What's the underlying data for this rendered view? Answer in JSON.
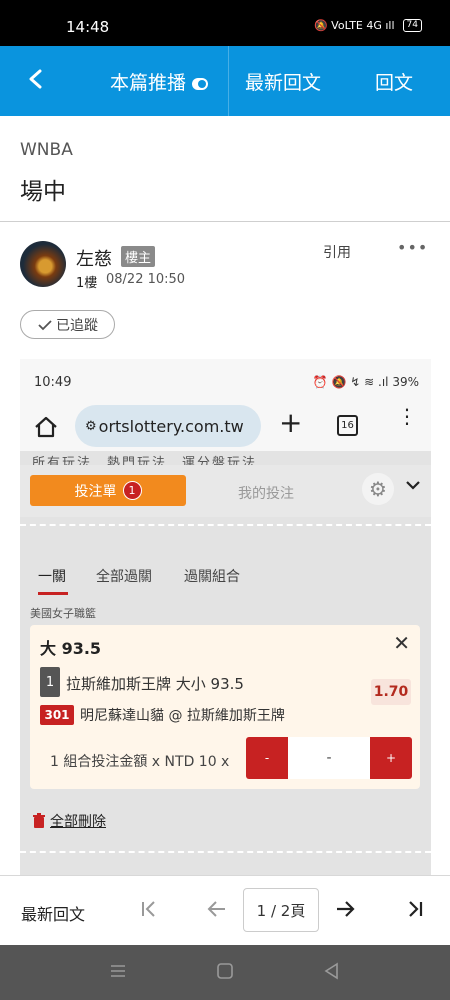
{
  "status_bar": {
    "time": "14:48",
    "indicators": "🔕 VoLTE 4G ıll",
    "battery": "74"
  },
  "app_bar": {
    "back_icon": "back-arrow-icon",
    "tabs": [
      {
        "label": "本篇推播",
        "toggle": "on"
      },
      {
        "label": "最新回文"
      },
      {
        "label": "回文"
      }
    ]
  },
  "thread": {
    "board": "WNBA",
    "title": "場中"
  },
  "post": {
    "author": "左慈",
    "badge": "樓主",
    "floor": "1樓",
    "datetime": "08/22 10:50",
    "quote_label": "引用",
    "more_label": "•••",
    "follow_label": "已追蹤"
  },
  "embedded": {
    "time": "10:49",
    "status_icons": "⏰ 🔕 ↯ ≋ .ıl 39%",
    "url": "ortslottery.com.tw",
    "tab_count": "16",
    "peek_text": "所有玩法　熱門玩法　運分盤玩法",
    "bet_slip_label": "投注單",
    "bet_count": "1",
    "my_bets_label": "我的投注",
    "modes": [
      "一關",
      "全部過關",
      "過關組合"
    ],
    "league": "美國女子職籃",
    "card": {
      "title": "大 93.5",
      "pick_num": "1",
      "pick_text": "拉斯維加斯王牌 大小 93.5",
      "game_num": "301",
      "game_text": "明尼蘇達山貓 @ 拉斯維加斯王牌",
      "odds": "1.70",
      "stake_label": "1 組合投注金額 x NTD 10 x",
      "minus": "-",
      "value": "-",
      "plus": "+"
    },
    "delete_all": "全部刪除"
  },
  "bottom_nav": {
    "latest_label": "最新回文",
    "page_label": "1 / 2頁"
  },
  "colors": {
    "brand_blue": "#0a94de",
    "accent_orange": "#f28a1e",
    "accent_red": "#c72222"
  }
}
